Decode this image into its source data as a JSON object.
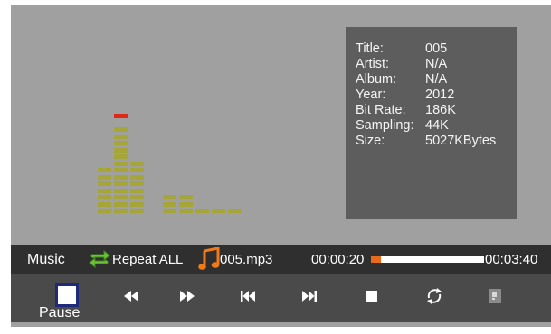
{
  "info": {
    "rows": [
      {
        "key": "Title:",
        "value": "005"
      },
      {
        "key": "Artist:",
        "value": "N/A"
      },
      {
        "key": "Album:",
        "value": "N/A"
      },
      {
        "key": "Year:",
        "value": "2012"
      },
      {
        "key": "Bit Rate:",
        "value": "186K"
      },
      {
        "key": "Sampling:",
        "value": "44K"
      },
      {
        "key": "Size:",
        "value": "5027KBytes"
      }
    ]
  },
  "status": {
    "source": "Music",
    "repeat_mode": "Repeat ALL",
    "file_name": "005.mp3",
    "elapsed": "00:00:20",
    "total": "00:03:40",
    "progress_fraction": 0.09
  },
  "controls": {
    "pause_label": "Pause",
    "buttons": [
      "stop-square-icon",
      "rewind-icon",
      "fast-forward-icon",
      "skip-previous-icon",
      "skip-next-icon",
      "stop-icon",
      "repeat-cycle-icon",
      "info-icon"
    ]
  },
  "spectrum": {
    "levels": [
      7,
      13,
      8,
      0,
      3,
      3,
      1,
      1,
      1
    ],
    "peaks": [
      0,
      14,
      0,
      0,
      0,
      0,
      0,
      0,
      0
    ],
    "colors": {
      "bar": "#a5a53a",
      "peak": "#e02818"
    }
  },
  "colors": {
    "progress_fill": "#e86a1a",
    "pause_border": "#1f2a7a"
  }
}
